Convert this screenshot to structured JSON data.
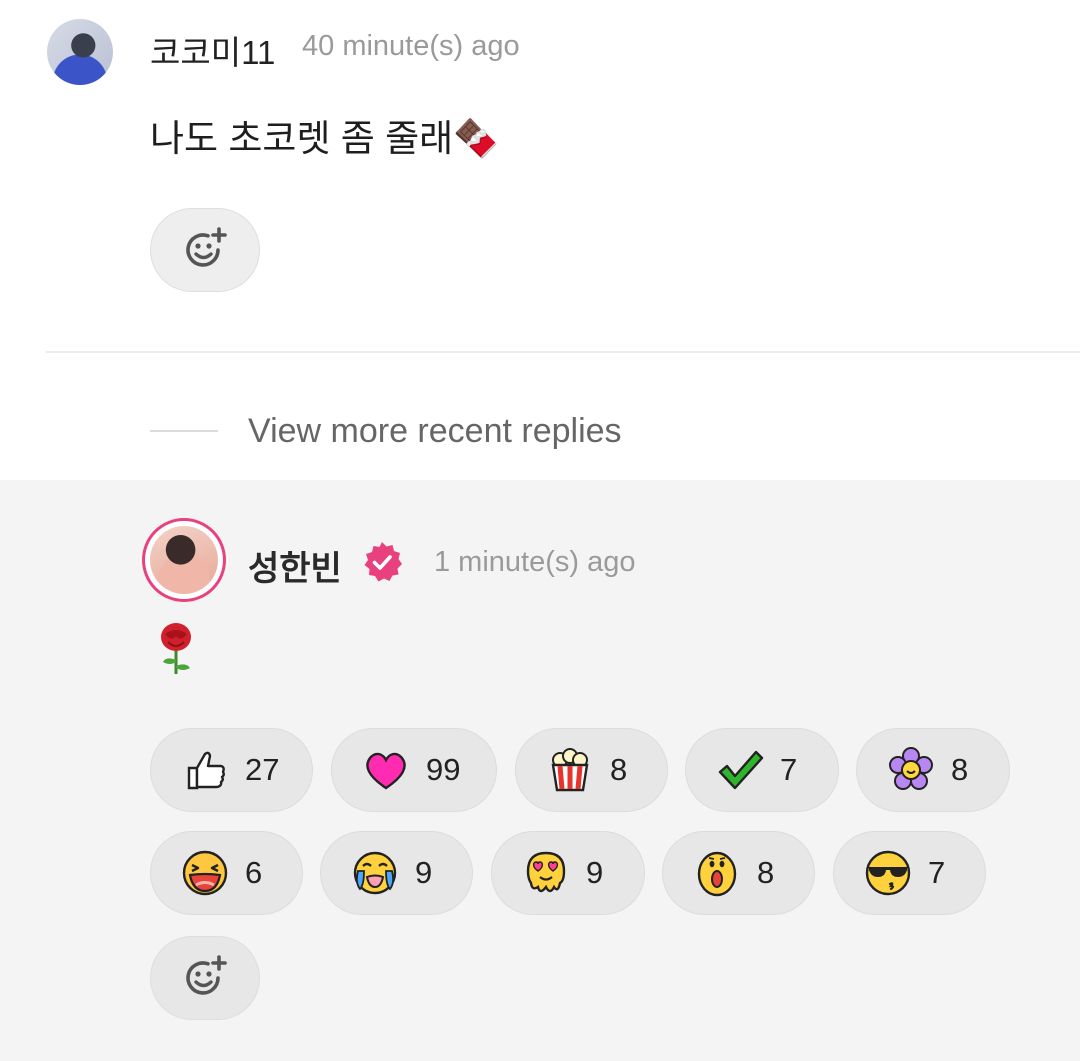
{
  "top_comment": {
    "username": "코코미11",
    "time": "40 minute(s) ago",
    "text": "나도 초코렛 좀 줄래🍫"
  },
  "view_more": "View more recent replies",
  "reply": {
    "username": "성한빈",
    "verified": true,
    "time": "1 minute(s) ago",
    "text": "🌹"
  },
  "reactions": [
    {
      "icon": "thumbs-up-icon",
      "count": "27"
    },
    {
      "icon": "heart-icon",
      "count": "99"
    },
    {
      "icon": "popcorn-icon",
      "count": "8"
    },
    {
      "icon": "checkmark-icon",
      "count": "7"
    },
    {
      "icon": "flower-icon",
      "count": "8"
    },
    {
      "icon": "laughing-face-icon",
      "count": "6"
    },
    {
      "icon": "crying-face-icon",
      "count": "9"
    },
    {
      "icon": "heart-eyes-melting-face-icon",
      "count": "9"
    },
    {
      "icon": "surprised-face-icon",
      "count": "8"
    },
    {
      "icon": "sunglasses-face-icon",
      "count": "7"
    }
  ],
  "colors": {
    "verified_badge": "#e8417e",
    "avatar_ring": "#e8417e",
    "reply_background": "#f4f4f4"
  }
}
